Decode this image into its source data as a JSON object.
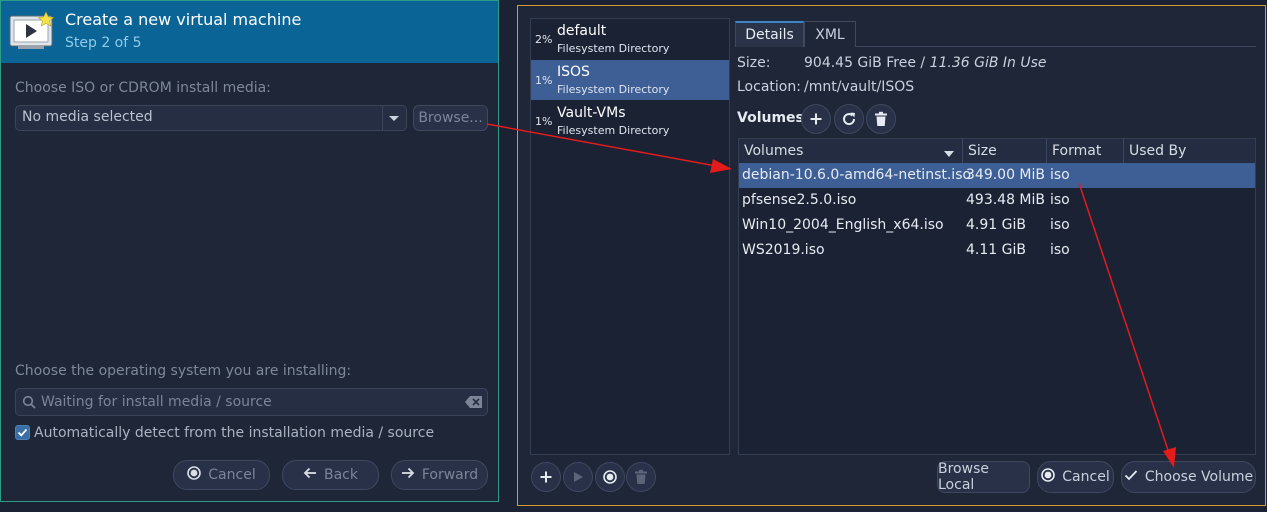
{
  "wizard": {
    "title": "Create a new virtual machine",
    "step": "Step 2 of 5",
    "iso_label": "Choose ISO or CDROM install media:",
    "media_value": "No media selected",
    "browse_label": "Browse...",
    "os_label": "Choose the operating system you are installing:",
    "os_placeholder": "Waiting for install media / source",
    "autodetect_label": "Automatically detect from the installation media / source",
    "autodetect_checked": true,
    "cancel_label": "Cancel",
    "back_label": "Back",
    "forward_label": "Forward"
  },
  "browser": {
    "pools": [
      {
        "usage": "2%",
        "name": "default",
        "type": "Filesystem Directory",
        "selected": false
      },
      {
        "usage": "1%",
        "name": "ISOS",
        "type": "Filesystem Directory",
        "selected": true
      },
      {
        "usage": "1%",
        "name": "Vault-VMs",
        "type": "Filesystem Directory",
        "selected": false
      }
    ],
    "tabs": {
      "details": "Details",
      "xml": "XML"
    },
    "size_label": "Size:",
    "size_free": "904.45 GiB Free / ",
    "size_used": "11.36 GiB In Use",
    "location_label": "Location:",
    "location_value": "/mnt/vault/ISOS",
    "volumes_label": "Volumes",
    "columns": {
      "volumes": "Volumes",
      "size": "Size",
      "format": "Format",
      "used_by": "Used By"
    },
    "volumes": [
      {
        "name": "debian-10.6.0-amd64-netinst.iso",
        "size": "349.00 MiB",
        "format": "iso",
        "used_by": "",
        "selected": true
      },
      {
        "name": "pfsense2.5.0.iso",
        "size": "493.48 MiB",
        "format": "iso",
        "used_by": "",
        "selected": false
      },
      {
        "name": "Win10_2004_English_x64.iso",
        "size": "4.91 GiB",
        "format": "iso",
        "used_by": "",
        "selected": false
      },
      {
        "name": "WS2019.iso",
        "size": "4.11 GiB",
        "format": "iso",
        "used_by": "",
        "selected": false
      }
    ],
    "browse_local_label": "Browse Local",
    "cancel_label": "Cancel",
    "choose_volume_label": "Choose Volume"
  },
  "colors": {
    "annotation_arrow": "#e31b1b",
    "selection": "#3d5f96",
    "header": "#0b6496",
    "focus_border": "#d69a2d"
  }
}
